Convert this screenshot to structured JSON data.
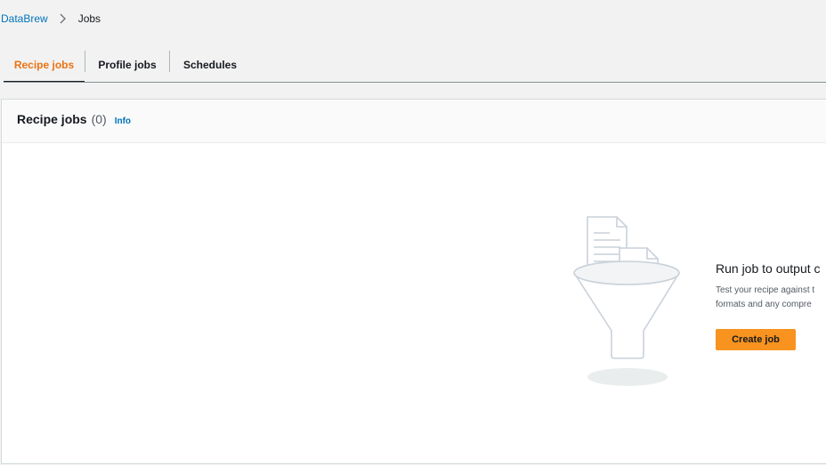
{
  "breadcrumb": {
    "root_label": "DataBrew",
    "current_label": "Jobs"
  },
  "tabs": [
    {
      "label": "Recipe jobs",
      "active": true
    },
    {
      "label": "Profile jobs",
      "active": false
    },
    {
      "label": "Schedules",
      "active": false
    }
  ],
  "panel": {
    "title": "Recipe jobs",
    "count": "(0)",
    "info_label": "Info"
  },
  "empty_state": {
    "heading": "Run job to output c",
    "description_line1": "Test your recipe against t",
    "description_line2": "formats and any compre",
    "create_button_label": "Create job"
  },
  "colors": {
    "accent": "#ec7211",
    "link": "#0073bb",
    "button": "#f7931e"
  }
}
